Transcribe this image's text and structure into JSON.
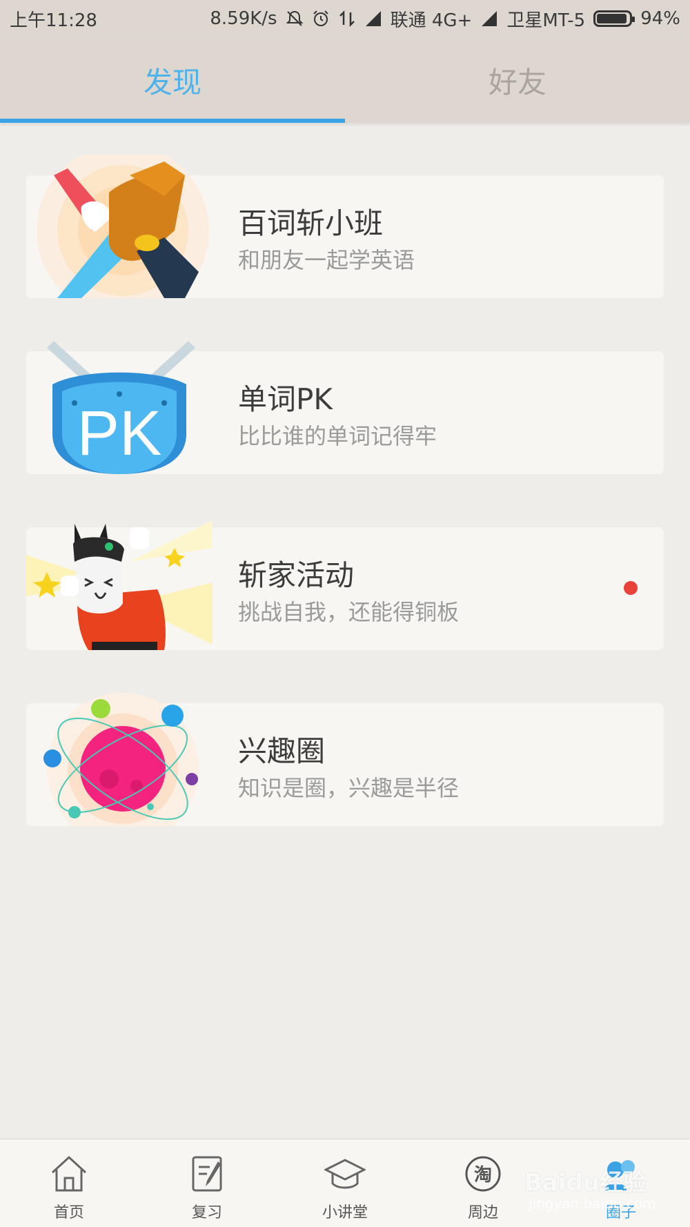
{
  "status_bar": {
    "time": "上午11:28",
    "speed": "8.59K/s",
    "carrier1": "联通 4G+",
    "carrier2": "卫星MT-5",
    "battery": "94%",
    "battery_level": 0.94,
    "icons": [
      "mute-icon",
      "alarm-icon",
      "data-arrows-icon",
      "signal-icon",
      "signal-icon",
      "battery-icon"
    ]
  },
  "tabs": [
    {
      "label": "发现",
      "active": true
    },
    {
      "label": "好友",
      "active": false
    }
  ],
  "colors": {
    "accent": "#3aa3e6",
    "tab_active": "#4fb2ea",
    "tab_inactive": "#aaa49d",
    "background": "#efede9",
    "card": "#f7f6f3",
    "badge": "#e8433a"
  },
  "cards": [
    {
      "title": "百词斩小班",
      "subtitle": "和朋友一起学英语",
      "icon": "handshake-icon"
    },
    {
      "title": "单词PK",
      "subtitle": "比比谁的单词记得牢",
      "icon": "pk-shield-icon",
      "badge_text": "PK"
    },
    {
      "title": "斩家活动",
      "subtitle": "挑战自我，还能得铜板",
      "icon": "cat-mascot-icon",
      "has_dot": true
    },
    {
      "title": "兴趣圈",
      "subtitle": "知识是圈，兴趣是半径",
      "icon": "planet-icon"
    }
  ],
  "bottom_nav": [
    {
      "label": "首页",
      "icon": "home-icon"
    },
    {
      "label": "复习",
      "icon": "review-icon"
    },
    {
      "label": "小讲堂",
      "icon": "graduation-cap-icon"
    },
    {
      "label": "周边",
      "icon": "taobao-icon",
      "icon_text": "淘"
    },
    {
      "label": "圈子",
      "icon": "circle-people-icon",
      "active": true
    }
  ],
  "watermark": {
    "text": "Baidu经验",
    "sub": "jingyan.baidu.com"
  }
}
